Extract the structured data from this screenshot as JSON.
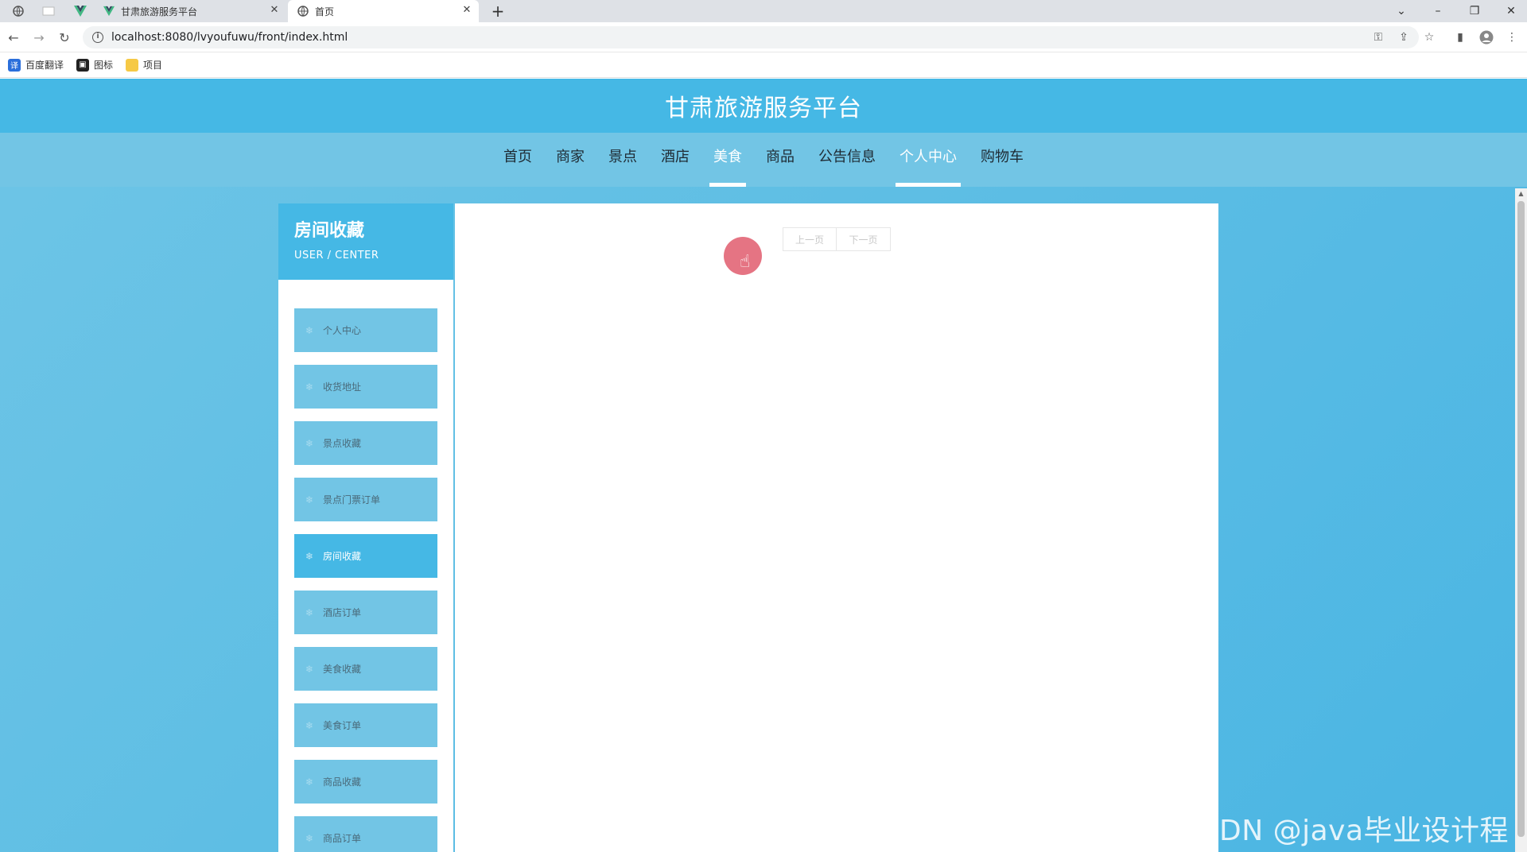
{
  "browser": {
    "tabs": [
      {
        "title": "甘肃旅游服务平台"
      },
      {
        "title": "首页"
      }
    ],
    "url": "localhost:8080/lvyoufuwu/front/index.html",
    "bookmarks": [
      "百度翻译",
      "图标",
      "项目"
    ]
  },
  "site": {
    "title": "甘肃旅游服务平台",
    "nav": [
      "首页",
      "商家",
      "景点",
      "酒店",
      "美食",
      "商品",
      "公告信息",
      "个人中心",
      "购物车"
    ],
    "active_nav": "个人中心"
  },
  "sidebar": {
    "title": "房间收藏",
    "subtitle": "USER / CENTER",
    "items": [
      "个人中心",
      "收货地址",
      "景点收藏",
      "景点门票订单",
      "房间收藏",
      "酒店订单",
      "美食收藏",
      "美食订单",
      "商品收藏",
      "商品订单"
    ],
    "active_item": "房间收藏"
  },
  "pager": {
    "prev": "上一页",
    "next": "下一页"
  },
  "watermark": "CSDN @java毕业设计程序"
}
